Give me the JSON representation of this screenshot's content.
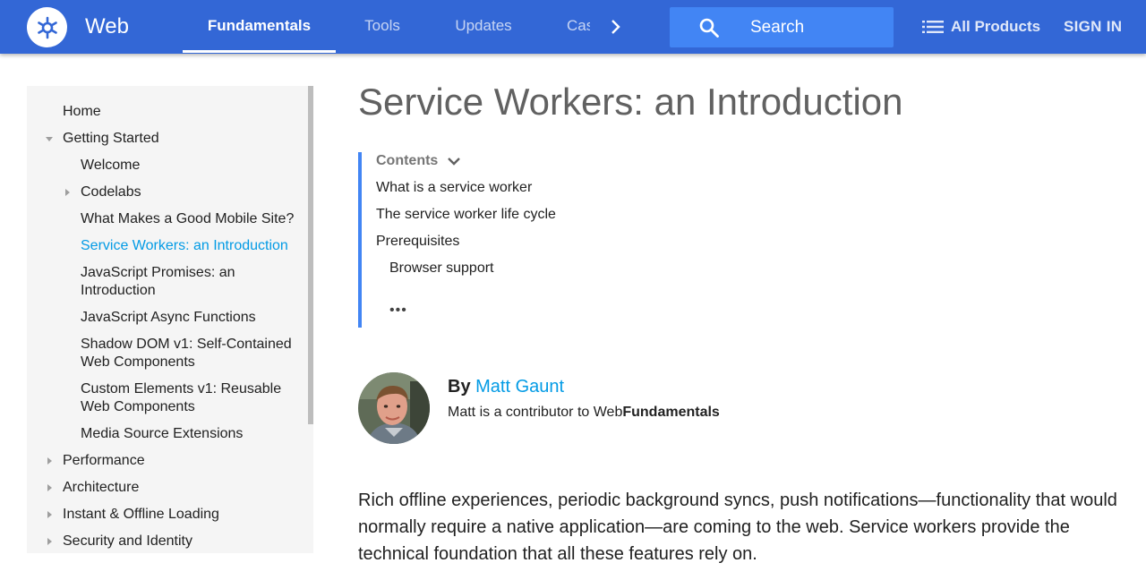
{
  "header": {
    "brand": "Web",
    "tabs": [
      {
        "label": "Fundamentals",
        "active": true
      },
      {
        "label": "Tools",
        "active": false
      },
      {
        "label": "Updates",
        "active": false
      },
      {
        "label": "Case Studies",
        "active": false
      }
    ],
    "search_label": "Search",
    "all_products": "All Products",
    "sign_in": "SIGN IN"
  },
  "sidebar": {
    "items": [
      {
        "label": "Home",
        "active": false
      },
      {
        "label": "Getting Started",
        "active": false,
        "expanded": true
      },
      {
        "label": "Welcome",
        "active": false
      },
      {
        "label": "Codelabs",
        "active": false,
        "expanded": false
      },
      {
        "label": "What Makes a Good Mobile Site?",
        "active": false
      },
      {
        "label": "Service Workers: an Introduction",
        "active": true
      },
      {
        "label": "JavaScript Promises: an Introduction",
        "active": false
      },
      {
        "label": "JavaScript Async Functions",
        "active": false
      },
      {
        "label": "Shadow DOM v1: Self-Contained Web Components",
        "active": false
      },
      {
        "label": "Custom Elements v1: Reusable Web Components",
        "active": false
      },
      {
        "label": "Media Source Extensions",
        "active": false
      },
      {
        "label": "Performance",
        "active": false,
        "expanded": false
      },
      {
        "label": "Architecture",
        "active": false,
        "expanded": false
      },
      {
        "label": "Instant & Offline Loading",
        "active": false,
        "expanded": false
      },
      {
        "label": "Security and Identity",
        "active": false,
        "expanded": false
      }
    ]
  },
  "main": {
    "title": "Service Workers: an Introduction",
    "toc": {
      "heading": "Contents",
      "links": [
        "What is a service worker",
        "The service worker life cycle",
        "Prerequisites",
        "Browser support"
      ],
      "more": "•••"
    },
    "author": {
      "by": "By",
      "name": "Matt Gaunt",
      "desc_prefix": "Matt is a contributor to Web",
      "desc_suffix": "Fundamentals"
    },
    "intro": "Rich offline experiences, periodic background syncs, push notifications—functionality that would normally require a native application—are coming to the web. Service workers provide the technical foundation that all these features rely on."
  },
  "colors": {
    "header_bg": "#3367d6",
    "search_bg": "#4285f4",
    "link": "#039be5",
    "toc_bar": "#4285f4",
    "sidebar_bg": "#f5f5f5"
  },
  "icons": [
    "web-logo-icon",
    "chevron-right-icon",
    "search-icon",
    "list-icon",
    "chevron-down-icon",
    "caret-down-icon",
    "caret-right-icon"
  ]
}
